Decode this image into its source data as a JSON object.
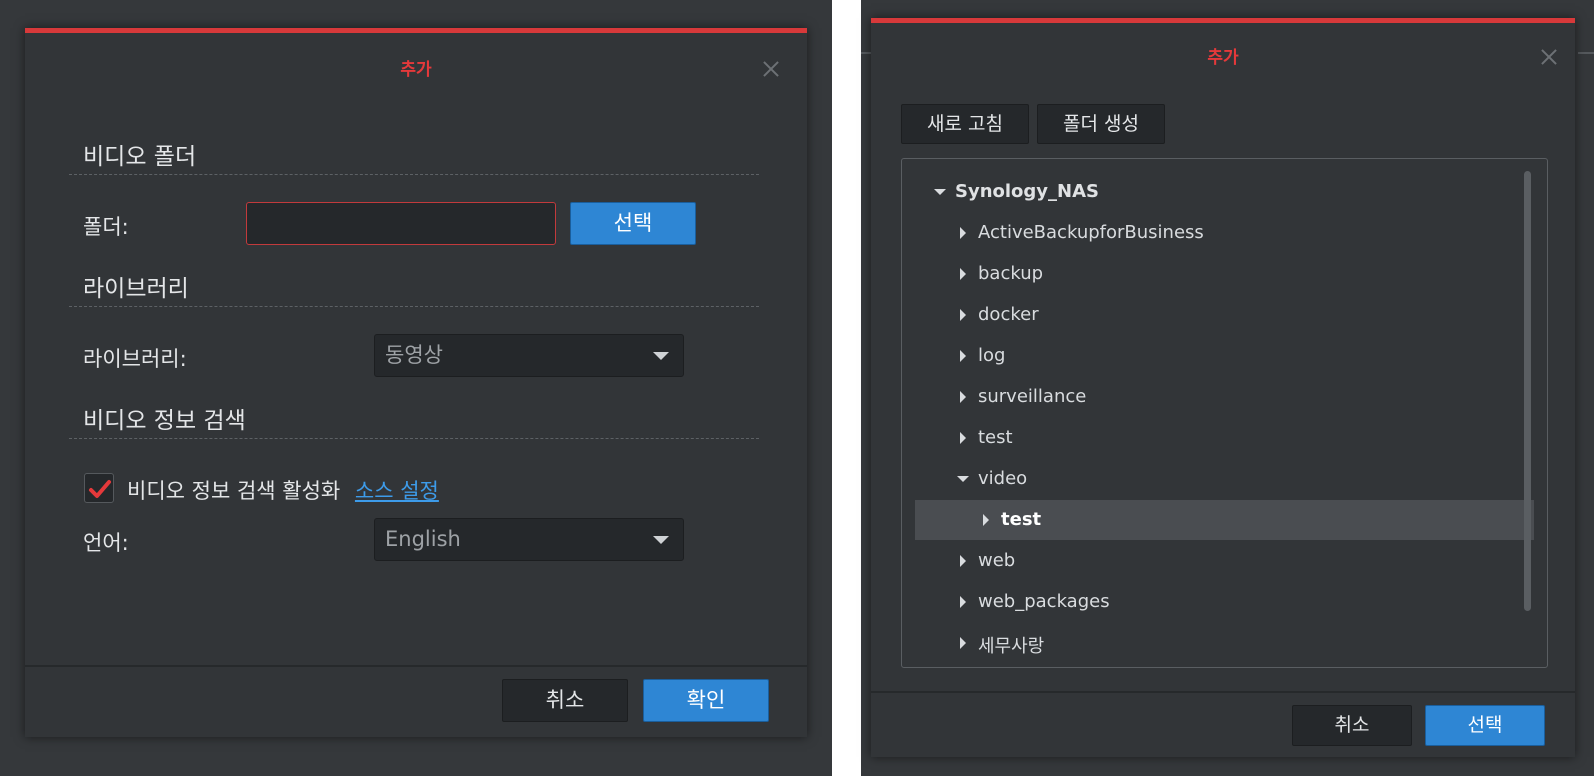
{
  "left_dialog": {
    "title": "추가",
    "sections": {
      "video_folder": "비디오 폴더",
      "library": "라이브러리",
      "video_info": "비디오 정보 검색"
    },
    "folder_label": "폴더:",
    "folder_value": "",
    "select_button": "선택",
    "library_label": "라이브러리:",
    "library_value": "동영상",
    "enable_label": "비디오 정보 검색 활성화",
    "source_link": "소스 설정",
    "enable_checked": true,
    "language_label": "언어:",
    "language_value": "English",
    "cancel_button": "취소",
    "ok_button": "확인"
  },
  "right_dialog": {
    "title": "추가",
    "refresh_button": "새로 고침",
    "create_folder_button": "폴더 생성",
    "tree": [
      {
        "label": "Synology_NAS",
        "level": 0,
        "expanded": true
      },
      {
        "label": "ActiveBackupforBusiness",
        "level": 1,
        "expanded": false
      },
      {
        "label": "backup",
        "level": 1,
        "expanded": false
      },
      {
        "label": "docker",
        "level": 1,
        "expanded": false
      },
      {
        "label": "log",
        "level": 1,
        "expanded": false
      },
      {
        "label": "surveillance",
        "level": 1,
        "expanded": false
      },
      {
        "label": "test",
        "level": 1,
        "expanded": false
      },
      {
        "label": "video",
        "level": 1,
        "expanded": true
      },
      {
        "label": "test",
        "level": 2,
        "expanded": false,
        "selected": true
      },
      {
        "label": "web",
        "level": 1,
        "expanded": false
      },
      {
        "label": "web_packages",
        "level": 1,
        "expanded": false
      },
      {
        "label": "세무사랑",
        "level": 1,
        "expanded": false
      }
    ],
    "cancel_button": "취소",
    "select_button": "선택"
  },
  "colors": {
    "accent_red": "#d7393a",
    "primary_blue": "#2e86d4",
    "link_blue": "#3d9be9"
  }
}
